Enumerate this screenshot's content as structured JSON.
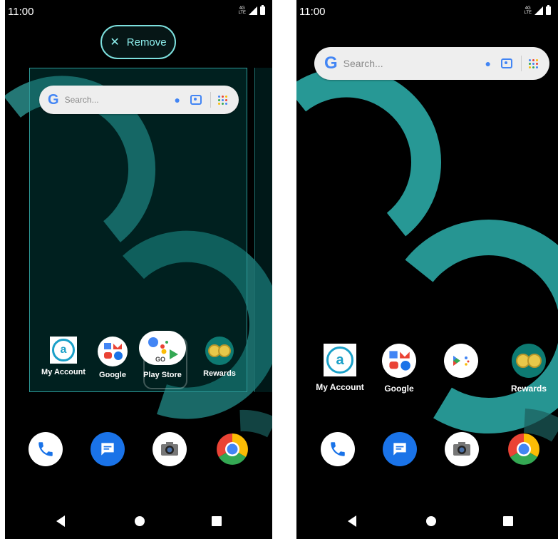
{
  "colors": {
    "accent_teal": "#3fc7c4",
    "frame_border": "#2e9a98",
    "background": "#000000"
  },
  "left": {
    "status": {
      "time": "11:00",
      "network": "4G LTE"
    },
    "remove_button": {
      "icon": "close-icon",
      "label": "Remove"
    },
    "search": {
      "placeholder": "Search..."
    },
    "apps": [
      {
        "label": "My Account"
      },
      {
        "label": "Google"
      },
      {
        "label": "Play Store"
      },
      {
        "label": "Rewards"
      }
    ],
    "play_overlay_text": "GO"
  },
  "right": {
    "status": {
      "time": "11:00",
      "network": "4G LTE"
    },
    "search": {
      "placeholder": "Search..."
    },
    "apps": [
      {
        "label": "My Account"
      },
      {
        "label": "Google"
      },
      {
        "label": "Rewards"
      }
    ]
  },
  "dock": [
    "phone-icon",
    "messages-icon",
    "camera-icon",
    "chrome-icon"
  ],
  "navbar": [
    "back-icon",
    "home-icon",
    "recents-icon"
  ]
}
